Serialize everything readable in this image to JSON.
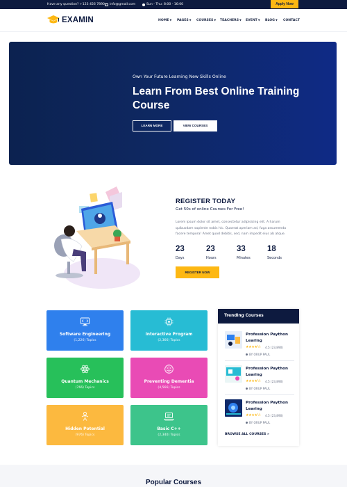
{
  "topbar": {
    "question": "Have any question? +123 456 7890",
    "email": "info@gmail.com",
    "hours": "Sun - Thu: 8:00 - 16:00",
    "apply_label": "Apply Now"
  },
  "header": {
    "logo_text": "EXAMIN",
    "nav": [
      "HOME",
      "PAGES",
      "COURSES",
      "TEACHERS",
      "EVENT",
      "BLOG",
      "CONTACT"
    ]
  },
  "hero": {
    "subtitle": "Own Your Future Learning New Skills Online",
    "title": "Learn From Best Online Training Course",
    "learn_more": "LEARN MORE",
    "view_courses": "VIEW COURSES"
  },
  "register": {
    "title": "REGISTER TODAY",
    "subtitle": "Get 50s of online Courses For Free!",
    "body": "Lorem ipsum dolor sit amet, consectetur adipisicing elit. A harum quibusdam sapiente nobis hic. Quaerat aperiam ad, fuga assumenda facere tempora! Amet quod debitis, sed, nam impedit eius ab atque.",
    "countdown": [
      {
        "value": "23",
        "label": "Days"
      },
      {
        "value": "23",
        "label": "Hours"
      },
      {
        "value": "33",
        "label": "Minutes"
      },
      {
        "value": "18",
        "label": "Seconds"
      }
    ],
    "button": "REGISTER NOW"
  },
  "categories": [
    {
      "name": "Software Engineering",
      "topics": "(1,226) Topics",
      "color": "#2f80ed",
      "icon": "monitor-code-icon"
    },
    {
      "name": "Interactive Program",
      "topics": "(2,366) Topics",
      "color": "#27bcd4",
      "icon": "circuit-icon"
    },
    {
      "name": "Quantum Mechanics",
      "topics": "(766) Topics",
      "color": "#27c05a",
      "icon": "atom-icon"
    },
    {
      "name": "Preventing Dementia",
      "topics": "(4,566) Topics",
      "color": "#e94bb5",
      "icon": "brain-icon"
    },
    {
      "name": "Hidden Potential",
      "topics": "(976) Topics",
      "color": "#fcb93f",
      "icon": "person-icon"
    },
    {
      "name": "Basic C++",
      "topics": "(2,340) Topics",
      "color": "#3dc48b",
      "icon": "laptop-icon"
    }
  ],
  "trending": {
    "heading": "Trending Courses",
    "courses": [
      {
        "title": "Profession Paython Learing",
        "stars": "★★★★½",
        "rating": "4.5 (23,890)",
        "author": "BY ORUP PAUL"
      },
      {
        "title": "Profession Paython Learing",
        "stars": "★★★★½",
        "rating": "4.5 (23,890)",
        "author": "BY ORUP PAUL"
      },
      {
        "title": "Profession Paython Learing",
        "stars": "★★★★½",
        "rating": "4.5 (23,890)",
        "author": "BY ORUP PAUL"
      }
    ],
    "browse": "BROWSE ALL COURSES »"
  },
  "popular": {
    "title": "Popular Courses"
  },
  "colors": {
    "navy": "#0d1a3f",
    "accent": "#fdb813"
  }
}
